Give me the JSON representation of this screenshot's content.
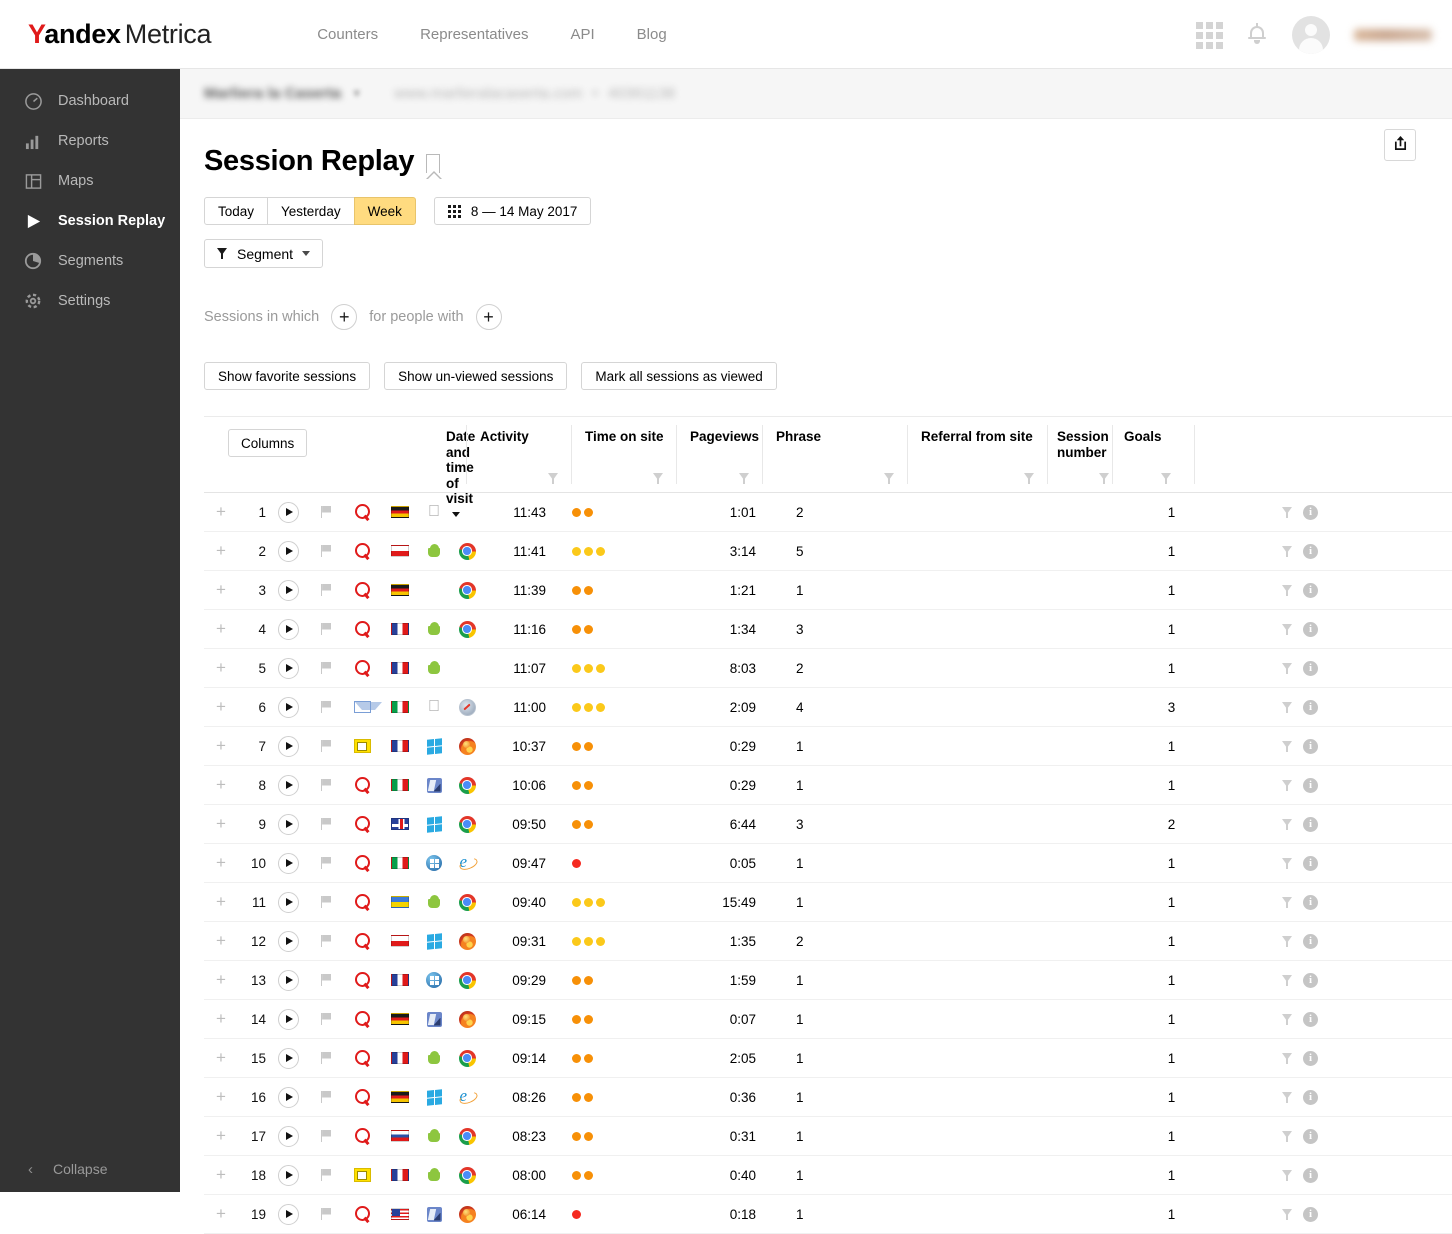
{
  "header": {
    "logo_y": "Y",
    "logo_andex": "andex",
    "logo_metrica": "Metrica",
    "nav": [
      {
        "label": "Counters"
      },
      {
        "label": "Representatives"
      },
      {
        "label": "API"
      },
      {
        "label": "Blog"
      }
    ]
  },
  "sidebar": {
    "items": [
      {
        "label": "Dashboard",
        "icon": "gauge-icon"
      },
      {
        "label": "Reports",
        "icon": "bar-chart-icon"
      },
      {
        "label": "Maps",
        "icon": "layout-icon"
      },
      {
        "label": "Session Replay",
        "icon": "play-icon"
      },
      {
        "label": "Segments",
        "icon": "pie-icon"
      },
      {
        "label": "Settings",
        "icon": "gear-icon"
      }
    ],
    "active_index": 3,
    "collapse_label": "Collapse"
  },
  "breadcrumb": {
    "counter_name": "Marliera la Caserta",
    "site": "www.marlieralacaserta.com",
    "counter_id": "40361138"
  },
  "page": {
    "title": "Session Replay",
    "export_icon": "share-export-icon"
  },
  "date_filter": {
    "buttons": [
      {
        "label": "Today",
        "active": false
      },
      {
        "label": "Yesterday",
        "active": false
      },
      {
        "label": "Week",
        "active": true
      }
    ],
    "range_label": "8 — 14 May 2017",
    "accent_color": "#ffdb80"
  },
  "segment": {
    "label": "Segment"
  },
  "sessions_filter": {
    "prefix_label": "Sessions in which",
    "middle_label": "for people with",
    "add_symbol": "+"
  },
  "actions": [
    {
      "label": "Show favorite sessions"
    },
    {
      "label": "Show un-viewed sessions"
    },
    {
      "label": "Mark all sessions as viewed"
    }
  ],
  "table": {
    "columns_button": "Columns",
    "headers": [
      {
        "label": "Date and time of visit",
        "sorted": true
      },
      {
        "label": "Activity",
        "filter": true
      },
      {
        "label": "Time on site",
        "filter": true
      },
      {
        "label": "Pageviews",
        "filter": true
      },
      {
        "label": "Phrase",
        "filter": true
      },
      {
        "label": "Referral from site",
        "filter": true
      },
      {
        "label": "Session number",
        "filter": true
      },
      {
        "label": "Goals",
        "filter": true
      }
    ],
    "activity_colors": {
      "low": "#f52a20",
      "medium": "#f79007",
      "high": "#fbc91a"
    },
    "rows": [
      {
        "n": "1",
        "source": "search",
        "country": "de",
        "os": "apple",
        "browser": "",
        "time": "11:43",
        "activity": "medium",
        "dots": 2,
        "on_site": "1:01",
        "pageviews": "2",
        "phrase": "",
        "referral": "",
        "session_number": "1"
      },
      {
        "n": "2",
        "source": "search",
        "country": "pl",
        "os": "android",
        "browser": "chrome",
        "time": "11:41",
        "activity": "high",
        "dots": 3,
        "on_site": "3:14",
        "pageviews": "5",
        "phrase": "",
        "referral": "",
        "session_number": "1"
      },
      {
        "n": "3",
        "source": "search",
        "country": "de",
        "os": "",
        "browser": "chrome",
        "time": "11:39",
        "activity": "medium",
        "dots": 2,
        "on_site": "1:21",
        "pageviews": "1",
        "phrase": "",
        "referral": "",
        "session_number": "1"
      },
      {
        "n": "4",
        "source": "search",
        "country": "fr",
        "os": "android",
        "browser": "chrome",
        "time": "11:16",
        "activity": "medium",
        "dots": 2,
        "on_site": "1:34",
        "pageviews": "3",
        "phrase": "",
        "referral": "",
        "session_number": "1"
      },
      {
        "n": "5",
        "source": "search",
        "country": "fr",
        "os": "android",
        "browser": "",
        "time": "11:07",
        "activity": "high",
        "dots": 3,
        "on_site": "8:03",
        "pageviews": "2",
        "phrase": "",
        "referral": "",
        "session_number": "1"
      },
      {
        "n": "6",
        "source": "mail",
        "country": "it",
        "os": "apple",
        "browser": "safari",
        "time": "11:00",
        "activity": "high",
        "dots": 3,
        "on_site": "2:09",
        "pageviews": "4",
        "phrase": "",
        "referral": "",
        "session_number": "3"
      },
      {
        "n": "7",
        "source": "ad",
        "country": "fr",
        "os": "win8",
        "browser": "firefox",
        "time": "10:37",
        "activity": "medium",
        "dots": 2,
        "on_site": "0:29",
        "pageviews": "1",
        "phrase": "",
        "referral": "",
        "session_number": "1"
      },
      {
        "n": "8",
        "source": "search",
        "country": "it",
        "os": "mac",
        "browser": "chrome",
        "time": "10:06",
        "activity": "medium",
        "dots": 2,
        "on_site": "0:29",
        "pageviews": "1",
        "phrase": "",
        "referral": "",
        "session_number": "1"
      },
      {
        "n": "9",
        "source": "search",
        "country": "gb",
        "os": "win8",
        "browser": "chrome",
        "time": "09:50",
        "activity": "medium",
        "dots": 2,
        "on_site": "6:44",
        "pageviews": "3",
        "phrase": "",
        "referral": "",
        "session_number": "2"
      },
      {
        "n": "10",
        "source": "search",
        "country": "it",
        "os": "win7",
        "browser": "ie",
        "time": "09:47",
        "activity": "low",
        "dots": 1,
        "on_site": "0:05",
        "pageviews": "1",
        "phrase": "",
        "referral": "",
        "session_number": "1"
      },
      {
        "n": "11",
        "source": "search",
        "country": "ua",
        "os": "android",
        "browser": "chrome",
        "time": "09:40",
        "activity": "high",
        "dots": 3,
        "on_site": "15:49",
        "pageviews": "1",
        "phrase": "",
        "referral": "",
        "session_number": "1"
      },
      {
        "n": "12",
        "source": "search",
        "country": "pl",
        "os": "win8",
        "browser": "firefox",
        "time": "09:31",
        "activity": "high",
        "dots": 3,
        "on_site": "1:35",
        "pageviews": "2",
        "phrase": "",
        "referral": "",
        "session_number": "1"
      },
      {
        "n": "13",
        "source": "search",
        "country": "fr",
        "os": "win7",
        "browser": "chrome",
        "time": "09:29",
        "activity": "medium",
        "dots": 2,
        "on_site": "1:59",
        "pageviews": "1",
        "phrase": "",
        "referral": "",
        "session_number": "1"
      },
      {
        "n": "14",
        "source": "search",
        "country": "de",
        "os": "mac",
        "browser": "firefox",
        "time": "09:15",
        "activity": "medium",
        "dots": 2,
        "on_site": "0:07",
        "pageviews": "1",
        "phrase": "",
        "referral": "",
        "session_number": "1"
      },
      {
        "n": "15",
        "source": "search",
        "country": "fr",
        "os": "android",
        "browser": "chrome",
        "time": "09:14",
        "activity": "medium",
        "dots": 2,
        "on_site": "2:05",
        "pageviews": "1",
        "phrase": "",
        "referral": "",
        "session_number": "1"
      },
      {
        "n": "16",
        "source": "search",
        "country": "de",
        "os": "win8",
        "browser": "ie",
        "time": "08:26",
        "activity": "medium",
        "dots": 2,
        "on_site": "0:36",
        "pageviews": "1",
        "phrase": "",
        "referral": "",
        "session_number": "1"
      },
      {
        "n": "17",
        "source": "search",
        "country": "ru",
        "os": "android",
        "browser": "chrome",
        "time": "08:23",
        "activity": "medium",
        "dots": 2,
        "on_site": "0:31",
        "pageviews": "1",
        "phrase": "",
        "referral": "",
        "session_number": "1"
      },
      {
        "n": "18",
        "source": "ad",
        "country": "fr",
        "os": "android",
        "browser": "chrome",
        "time": "08:00",
        "activity": "medium",
        "dots": 2,
        "on_site": "0:40",
        "pageviews": "1",
        "phrase": "",
        "referral": "",
        "session_number": "1"
      },
      {
        "n": "19",
        "source": "search",
        "country": "us",
        "os": "mac",
        "browser": "firefox",
        "time": "06:14",
        "activity": "low",
        "dots": 1,
        "on_site": "0:18",
        "pageviews": "1",
        "phrase": "",
        "referral": "",
        "session_number": "1"
      }
    ]
  }
}
